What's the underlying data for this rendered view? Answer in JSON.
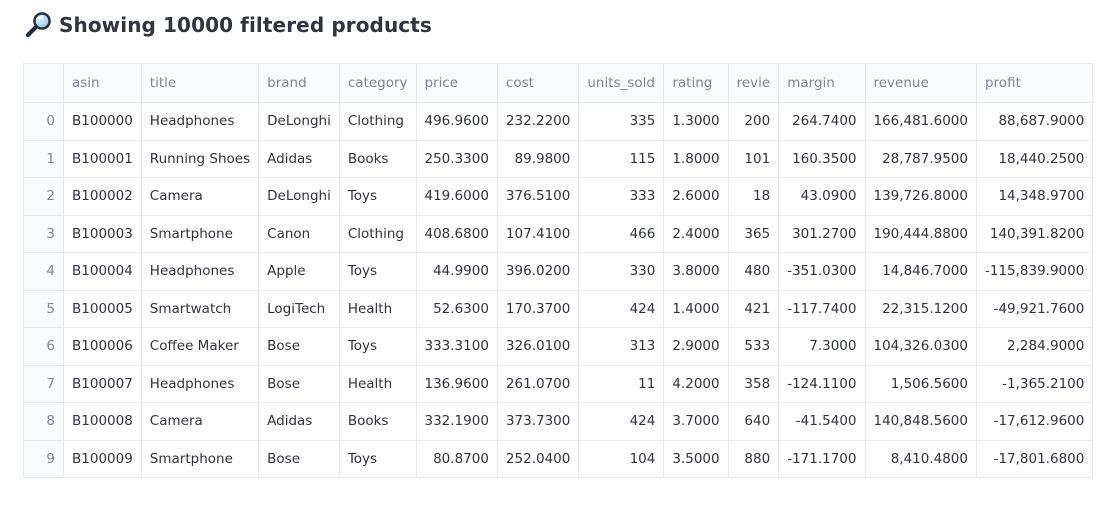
{
  "header": {
    "icon": "magnifier-icon",
    "title": "Showing 10000 filtered products"
  },
  "table": {
    "columns": [
      "asin",
      "title",
      "brand",
      "category",
      "price",
      "cost",
      "units_sold",
      "rating",
      "revie",
      "margin",
      "revenue",
      "profit"
    ],
    "column_align": [
      "txt",
      "txt",
      "txt",
      "txt",
      "num",
      "num",
      "num",
      "num",
      "num",
      "num",
      "num",
      "num"
    ],
    "rows": [
      {
        "index": "0",
        "cells": [
          "B100000",
          "Headphones",
          "DeLonghi",
          "Clothing",
          "496.9600",
          "232.2200",
          "335",
          "1.3000",
          "200",
          "264.7400",
          "166,481.6000",
          "88,687.9000"
        ]
      },
      {
        "index": "1",
        "cells": [
          "B100001",
          "Running Shoes",
          "Adidas",
          "Books",
          "250.3300",
          "89.9800",
          "115",
          "1.8000",
          "101",
          "160.3500",
          "28,787.9500",
          "18,440.2500"
        ]
      },
      {
        "index": "2",
        "cells": [
          "B100002",
          "Camera",
          "DeLonghi",
          "Toys",
          "419.6000",
          "376.5100",
          "333",
          "2.6000",
          "18",
          "43.0900",
          "139,726.8000",
          "14,348.9700"
        ]
      },
      {
        "index": "3",
        "cells": [
          "B100003",
          "Smartphone",
          "Canon",
          "Clothing",
          "408.6800",
          "107.4100",
          "466",
          "2.4000",
          "365",
          "301.2700",
          "190,444.8800",
          "140,391.8200"
        ]
      },
      {
        "index": "4",
        "cells": [
          "B100004",
          "Headphones",
          "Apple",
          "Toys",
          "44.9900",
          "396.0200",
          "330",
          "3.8000",
          "480",
          "-351.0300",
          "14,846.7000",
          "-115,839.9000"
        ]
      },
      {
        "index": "5",
        "cells": [
          "B100005",
          "Smartwatch",
          "LogiTech",
          "Health",
          "52.6300",
          "170.3700",
          "424",
          "1.4000",
          "421",
          "-117.7400",
          "22,315.1200",
          "-49,921.7600"
        ]
      },
      {
        "index": "6",
        "cells": [
          "B100006",
          "Coffee Maker",
          "Bose",
          "Toys",
          "333.3100",
          "326.0100",
          "313",
          "2.9000",
          "533",
          "7.3000",
          "104,326.0300",
          "2,284.9000"
        ]
      },
      {
        "index": "7",
        "cells": [
          "B100007",
          "Headphones",
          "Bose",
          "Health",
          "136.9600",
          "261.0700",
          "11",
          "4.2000",
          "358",
          "-124.1100",
          "1,506.5600",
          "-1,365.2100"
        ]
      },
      {
        "index": "8",
        "cells": [
          "B100008",
          "Camera",
          "Adidas",
          "Books",
          "332.1900",
          "373.7300",
          "424",
          "3.7000",
          "640",
          "-41.5400",
          "140,848.5600",
          "-17,612.9600"
        ]
      },
      {
        "index": "9",
        "cells": [
          "B100009",
          "Smartphone",
          "Bose",
          "Toys",
          "80.8700",
          "252.0400",
          "104",
          "3.5000",
          "880",
          "-171.1700",
          "8,410.4800",
          "-17,801.6800"
        ]
      }
    ]
  }
}
